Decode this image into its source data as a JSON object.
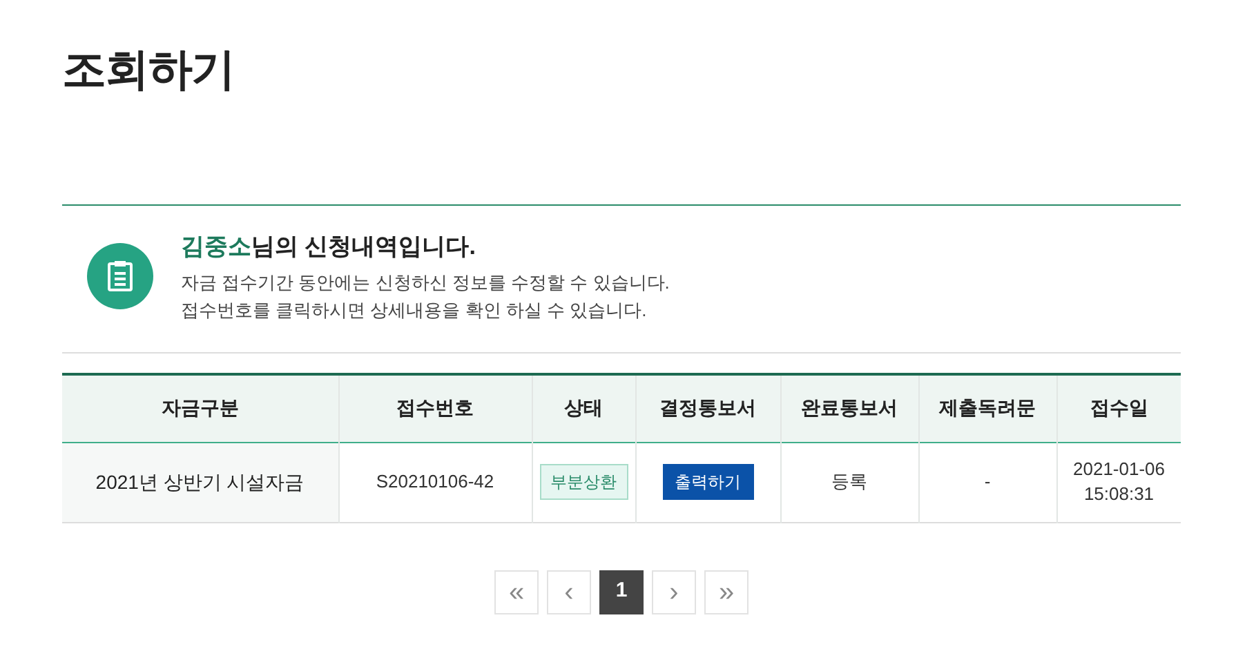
{
  "page_title": "조회하기",
  "notice": {
    "heading": "**김중소**님의 신청내역입니다.",
    "lines": [
      "자금 접수기간 동안에는 신청하신 정보를 수정할 수 있습니다.",
      "접수번호를 클릭하시면 상세내용을 확인 하실 수 있습니다."
    ]
  },
  "table": {
    "columns": [
      "자금구분",
      "접수번호",
      "상태",
      "결정통보서",
      "완료통보서",
      "제출독려문",
      "접수일"
    ],
    "rows": [
      {
        "cells": [
          {
            "kind": "text",
            "text": "2021년 상반기 시설자금"
          },
          {
            "kind": "link",
            "text": "S20210106-42"
          },
          {
            "kind": "badge",
            "text": "부분상환"
          },
          {
            "kind": "button",
            "text": "출력하기"
          },
          {
            "kind": "link",
            "text": "등록"
          },
          {
            "kind": "text",
            "text": "-"
          },
          {
            "kind": "datetime",
            "text": "2021-01-06",
            "time": "15:08:31"
          }
        ]
      }
    ]
  },
  "pagination": [
    {
      "label": "«",
      "selected": false
    },
    {
      "label": "‹",
      "selected": false
    },
    {
      "label": "1",
      "selected": true
    },
    {
      "label": "›",
      "selected": false
    },
    {
      "label": "»",
      "selected": false
    }
  ]
}
